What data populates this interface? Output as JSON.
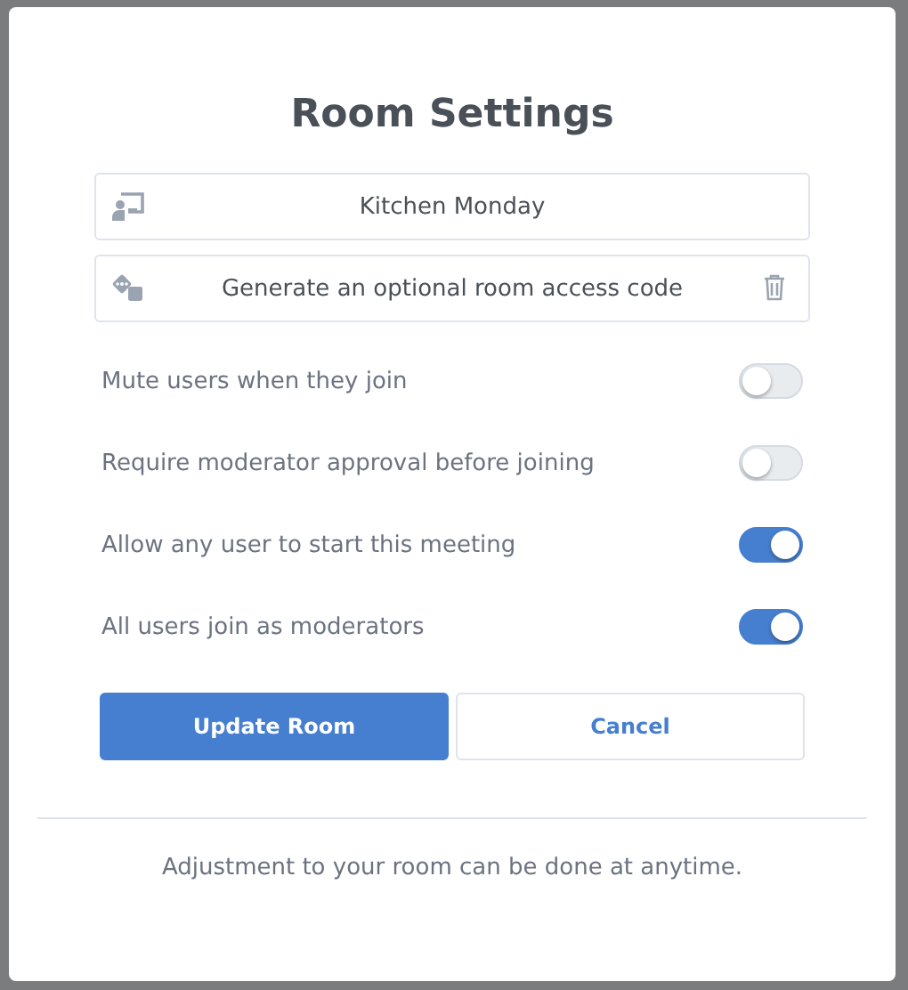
{
  "dialog": {
    "title": "Room Settings",
    "name_field": {
      "value": "Kitchen Monday"
    },
    "access_code_field": {
      "placeholder": "Generate an optional room access code"
    },
    "settings": [
      {
        "label": "Mute users when they join",
        "on": false
      },
      {
        "label": "Require moderator approval before joining",
        "on": false
      },
      {
        "label": "Allow any user to start this meeting",
        "on": true
      },
      {
        "label": "All users join as moderators",
        "on": true
      }
    ],
    "buttons": [
      {
        "label": "Update Room",
        "kind": "primary"
      },
      {
        "label": "Cancel",
        "kind": "secondary"
      }
    ],
    "footer": "Adjustment to your room can be done at anytime."
  }
}
